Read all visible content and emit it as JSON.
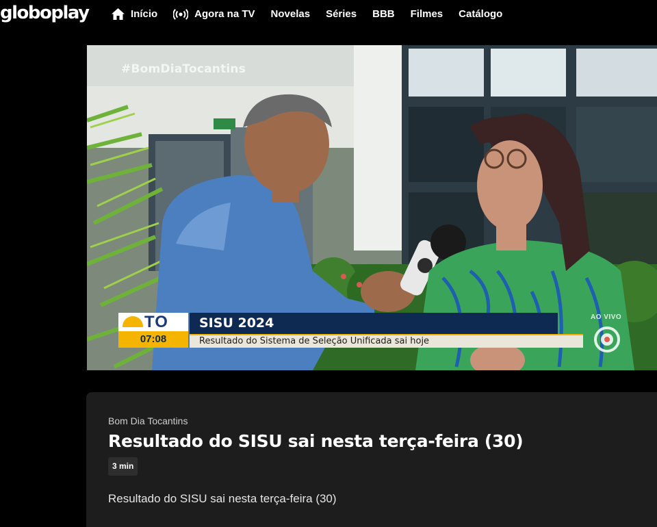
{
  "header": {
    "logo": "globoplay",
    "nav": [
      {
        "label": "Início",
        "icon": "home-icon"
      },
      {
        "label": "Agora na TV",
        "icon": "live-broadcast-icon"
      },
      {
        "label": "Novelas"
      },
      {
        "label": "Séries"
      },
      {
        "label": "BBB"
      },
      {
        "label": "Filmes"
      },
      {
        "label": "Catálogo"
      }
    ]
  },
  "player": {
    "hashtag": "#BomDiaTocantins",
    "lower_third": {
      "station": "TO",
      "time": "07:08",
      "headline": "SISU 2024",
      "subline": "Resultado do Sistema de Seleção Unificada sai hoje"
    },
    "live_tag": "AO VIVO"
  },
  "video_info": {
    "program": "Bom Dia Tocantins",
    "title": "Resultado do SISU sai nesta terça-feira (30)",
    "duration": "3 min",
    "description": "Resultado do SISU sai nesta terça-feira (30)"
  },
  "colors": {
    "background": "#000000",
    "card": "#1d1d1d",
    "lower_third_navy": "#0e2a52",
    "lower_third_yellow": "#f4b400"
  }
}
